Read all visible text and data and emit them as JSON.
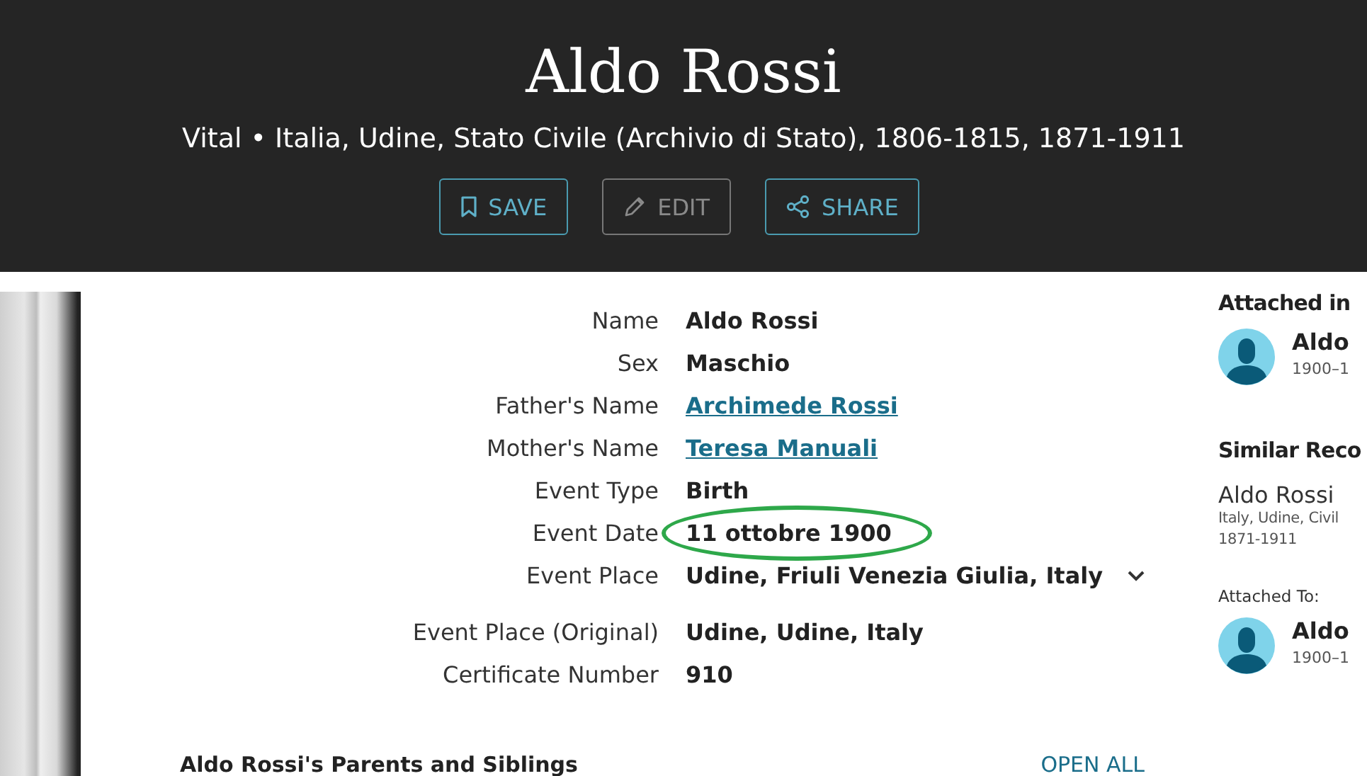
{
  "header": {
    "title": "Aldo Rossi",
    "subtitle": "Vital • Italia, Udine, Stato Civile (Archivio di Stato), 1806-1815, 1871-1911"
  },
  "buttons": [
    {
      "kind": "save",
      "label": "SAVE",
      "disabled": false
    },
    {
      "kind": "edit",
      "label": "EDIT",
      "disabled": true
    },
    {
      "kind": "share",
      "label": "SHARE",
      "disabled": false
    }
  ],
  "fields": [
    {
      "label": "Name",
      "value": "Aldo Rossi",
      "kind": "text",
      "highlighted": false
    },
    {
      "label": "Sex",
      "value": "Maschio",
      "kind": "text",
      "highlighted": false
    },
    {
      "label": "Father's Name",
      "value": "Archimede Rossi",
      "kind": "link",
      "highlighted": false
    },
    {
      "label": "Mother's Name",
      "value": "Teresa Manuali",
      "kind": "link",
      "highlighted": false
    },
    {
      "label": "Event Type",
      "value": "Birth",
      "kind": "text",
      "highlighted": false
    },
    {
      "label": "Event Date",
      "value": "11 ottobre 1900",
      "kind": "text",
      "highlighted": true
    },
    {
      "label": "Event Place",
      "value": "Udine, Friuli Venezia Giulia, Italy",
      "kind": "expandable",
      "expanded": false,
      "highlighted": false
    },
    {
      "label": "Event Place (Original)",
      "value": "Udine, Udine, Italy",
      "kind": "text",
      "highlighted": false
    },
    {
      "label": "Certificate Number",
      "value": "910",
      "kind": "text",
      "highlighted": false
    }
  ],
  "sidebar": {
    "attached_heading": "Attached in",
    "attached_person": {
      "name": "Aldo",
      "dates": "1900–1"
    },
    "similar_heading": "Similar Reco",
    "similar_record": {
      "name": "Aldo Rossi",
      "collection": "Italy, Udine, Civil",
      "years": "1871-1911",
      "attached_label": "Attached To:",
      "person": {
        "name": "Aldo",
        "dates": "1900–1"
      }
    }
  },
  "section": {
    "title": "Aldo Rossi's Parents and Siblings",
    "action": "OPEN ALL"
  }
}
